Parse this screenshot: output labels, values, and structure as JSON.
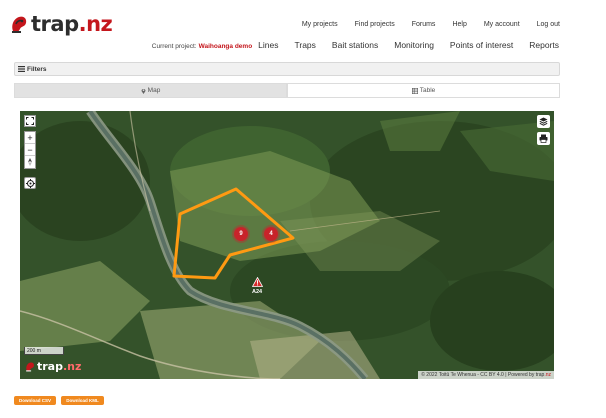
{
  "brand": {
    "name_dark": "trap",
    "name_accent": ".nz",
    "accent_color": "#c4161c",
    "button_color": "#f0891f"
  },
  "topnav": [
    "My projects",
    "Find projects",
    "Forums",
    "Help",
    "My account",
    "Log out"
  ],
  "subnav": {
    "current_label": "Current project:",
    "current_value": "Waihoanga demo",
    "items": [
      "Lines",
      "Traps",
      "Bait stations",
      "Monitoring",
      "Points of interest",
      "Reports"
    ]
  },
  "filters": {
    "label": "Filters"
  },
  "tabs": [
    {
      "label": "Map",
      "active": true
    },
    {
      "label": "Table",
      "active": false
    }
  ],
  "map": {
    "scale_text": "200 m",
    "clusters": [
      "9",
      "4"
    ],
    "trap_label": "A24",
    "attribution_prefix": "© 2022 Toitū Te Whenua - CC BY 4.0 | Powered by trap",
    "attribution_accent": ".nz",
    "logo_dark": "trap",
    "logo_accent": ".nz"
  },
  "downloads": [
    "Download CSV",
    "Download KML"
  ]
}
